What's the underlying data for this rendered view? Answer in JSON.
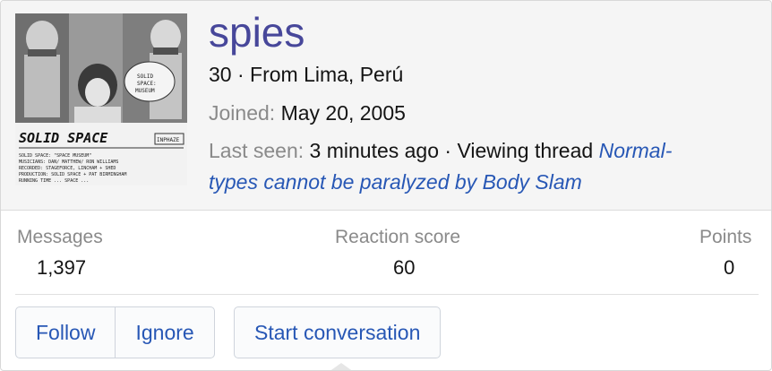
{
  "user": {
    "name": "spies",
    "age_location": "30 · From Lima, Perú",
    "joined_label": "Joined:",
    "joined_value": "May 20, 2005",
    "last_seen_label": "Last seen:",
    "last_seen_value": "3 minutes ago · Viewing thread",
    "thread_line1": "Normal-",
    "thread_line2": "types cannot be paralyzed by Body Slam"
  },
  "avatar": {
    "title": "SOLID SPACE",
    "badge": "INPHAZE",
    "bubble": "SOLID SPACE: SPACE MUSEUM",
    "credits": [
      "SOLID SPACE: \"SPACE MUSEUM\"",
      "MUSICIANS: DAN/ MATTHEW/ RON WILLIAMS (?)",
      "RECORDED: STAGEFORCE, LINCHAM + THE SHED, ELFORD",
      "PRODUCTION: SOLID SPACE + PAT BIRMINGHAM",
      "RUNNING TIME: ... SPACE... SOLID SPACE"
    ]
  },
  "stats": [
    {
      "label": "Messages",
      "value": "1,397"
    },
    {
      "label": "Reaction score",
      "value": "60"
    },
    {
      "label": "Points",
      "value": "0"
    }
  ],
  "buttons": {
    "follow": "Follow",
    "ignore": "Ignore",
    "start_conversation": "Start conversation"
  },
  "colors": {
    "username": "#47479a",
    "link": "#2757b5",
    "muted": "#8a8a8a",
    "header_bg": "#f5f5f5"
  }
}
